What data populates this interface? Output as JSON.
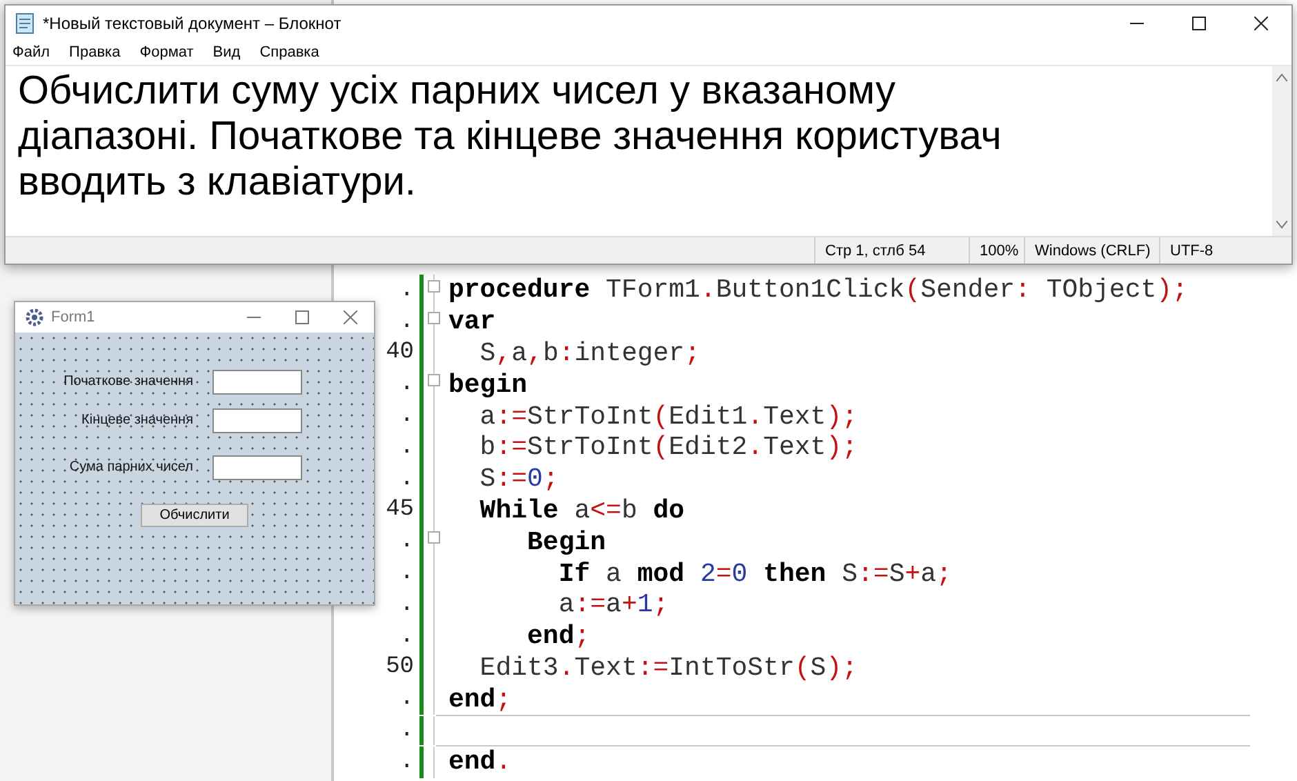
{
  "editor": {
    "lines": [
      {
        "gutter": ".",
        "fold": true,
        "tokens": [
          {
            "kind": "kw",
            "text": "procedure"
          },
          {
            "kind": "id",
            "text": " TForm1"
          },
          {
            "kind": "sym",
            "text": "."
          },
          {
            "kind": "id",
            "text": "Button1Click"
          },
          {
            "kind": "sym",
            "text": "("
          },
          {
            "kind": "id",
            "text": "Sender"
          },
          {
            "kind": "sym",
            "text": ":"
          },
          {
            "kind": "id",
            "text": " TObject"
          },
          {
            "kind": "sym",
            "text": ");"
          }
        ]
      },
      {
        "gutter": ".",
        "fold": true,
        "tokens": [
          {
            "kind": "kw",
            "text": "var"
          }
        ]
      },
      {
        "gutter": "40",
        "fold": false,
        "tokens": [
          {
            "kind": "id",
            "text": "  S"
          },
          {
            "kind": "sym",
            "text": ","
          },
          {
            "kind": "id",
            "text": "a"
          },
          {
            "kind": "sym",
            "text": ","
          },
          {
            "kind": "id",
            "text": "b"
          },
          {
            "kind": "sym",
            "text": ":"
          },
          {
            "kind": "id",
            "text": "integer"
          },
          {
            "kind": "sym",
            "text": ";"
          }
        ]
      },
      {
        "gutter": ".",
        "fold": true,
        "tokens": [
          {
            "kind": "kw",
            "text": "begin"
          }
        ]
      },
      {
        "gutter": ".",
        "fold": false,
        "tokens": [
          {
            "kind": "id",
            "text": "  a"
          },
          {
            "kind": "sym",
            "text": ":="
          },
          {
            "kind": "id",
            "text": "StrToInt"
          },
          {
            "kind": "sym",
            "text": "("
          },
          {
            "kind": "id",
            "text": "Edit1"
          },
          {
            "kind": "sym",
            "text": "."
          },
          {
            "kind": "id",
            "text": "Text"
          },
          {
            "kind": "sym",
            "text": ");"
          }
        ]
      },
      {
        "gutter": ".",
        "fold": false,
        "tokens": [
          {
            "kind": "id",
            "text": "  b"
          },
          {
            "kind": "sym",
            "text": ":="
          },
          {
            "kind": "id",
            "text": "StrToInt"
          },
          {
            "kind": "sym",
            "text": "("
          },
          {
            "kind": "id",
            "text": "Edit2"
          },
          {
            "kind": "sym",
            "text": "."
          },
          {
            "kind": "id",
            "text": "Text"
          },
          {
            "kind": "sym",
            "text": ");"
          }
        ]
      },
      {
        "gutter": ".",
        "fold": false,
        "tokens": [
          {
            "kind": "id",
            "text": "  S"
          },
          {
            "kind": "sym",
            "text": ":="
          },
          {
            "kind": "num",
            "text": "0"
          },
          {
            "kind": "sym",
            "text": ";"
          }
        ]
      },
      {
        "gutter": "45",
        "fold": false,
        "tokens": [
          {
            "kind": "kw",
            "text": "  While"
          },
          {
            "kind": "id",
            "text": " a"
          },
          {
            "kind": "sym",
            "text": "<="
          },
          {
            "kind": "id",
            "text": "b "
          },
          {
            "kind": "kw",
            "text": "do"
          }
        ]
      },
      {
        "gutter": ".",
        "fold": true,
        "tokens": [
          {
            "kind": "kw",
            "text": "     Begin"
          }
        ]
      },
      {
        "gutter": ".",
        "fold": false,
        "tokens": [
          {
            "kind": "kw",
            "text": "       If"
          },
          {
            "kind": "id",
            "text": " a "
          },
          {
            "kind": "kw",
            "text": "mod"
          },
          {
            "kind": "num",
            "text": " 2"
          },
          {
            "kind": "sym",
            "text": "="
          },
          {
            "kind": "num",
            "text": "0 "
          },
          {
            "kind": "kw",
            "text": "then"
          },
          {
            "kind": "id",
            "text": " S"
          },
          {
            "kind": "sym",
            "text": ":="
          },
          {
            "kind": "id",
            "text": "S"
          },
          {
            "kind": "sym",
            "text": "+"
          },
          {
            "kind": "id",
            "text": "a"
          },
          {
            "kind": "sym",
            "text": ";"
          }
        ]
      },
      {
        "gutter": ".",
        "fold": false,
        "tokens": [
          {
            "kind": "id",
            "text": "       a"
          },
          {
            "kind": "sym",
            "text": ":="
          },
          {
            "kind": "id",
            "text": "a"
          },
          {
            "kind": "sym",
            "text": "+"
          },
          {
            "kind": "num",
            "text": "1"
          },
          {
            "kind": "sym",
            "text": ";"
          }
        ]
      },
      {
        "gutter": ".",
        "fold": false,
        "tokens": [
          {
            "kind": "kw",
            "text": "     end"
          },
          {
            "kind": "sym",
            "text": ";"
          }
        ]
      },
      {
        "gutter": "50",
        "fold": false,
        "tokens": [
          {
            "kind": "id",
            "text": "  Edit3"
          },
          {
            "kind": "sym",
            "text": "."
          },
          {
            "kind": "id",
            "text": "Text"
          },
          {
            "kind": "sym",
            "text": ":="
          },
          {
            "kind": "id",
            "text": "IntToStr"
          },
          {
            "kind": "sym",
            "text": "("
          },
          {
            "kind": "id",
            "text": "S"
          },
          {
            "kind": "sym",
            "text": ");"
          }
        ]
      },
      {
        "gutter": ".",
        "fold": false,
        "tokens": [
          {
            "kind": "kw",
            "text": "end"
          },
          {
            "kind": "sym",
            "text": ";"
          }
        ]
      },
      {
        "gutter": ".",
        "fold": false
      },
      {
        "gutter": ".",
        "fold": false,
        "tokens": [
          {
            "kind": "kw",
            "text": "end"
          },
          {
            "kind": "sym",
            "text": "."
          }
        ]
      }
    ]
  },
  "notepad": {
    "title": "*Новый текстовый документ – Блокнот",
    "menu": [
      "Файл",
      "Правка",
      "Формат",
      "Вид",
      "Справка"
    ],
    "text_lines": [
      "Обчислити суму усіх парних чисел у вказаному",
      "діапазоні. Початкове та кінцеве значення користувач",
      "вводить з клавіатури."
    ],
    "status_bar": [
      "Стр 1, стлб 54",
      "100%",
      "Windows (CRLF)",
      "UTF-8"
    ]
  },
  "form": {
    "title": "Form1",
    "fields": [
      {
        "label": "Початкове значення"
      },
      {
        "label": "Кінцеве значення"
      },
      {
        "label": "Сума парних чисел"
      }
    ],
    "button": "Обчислити"
  }
}
